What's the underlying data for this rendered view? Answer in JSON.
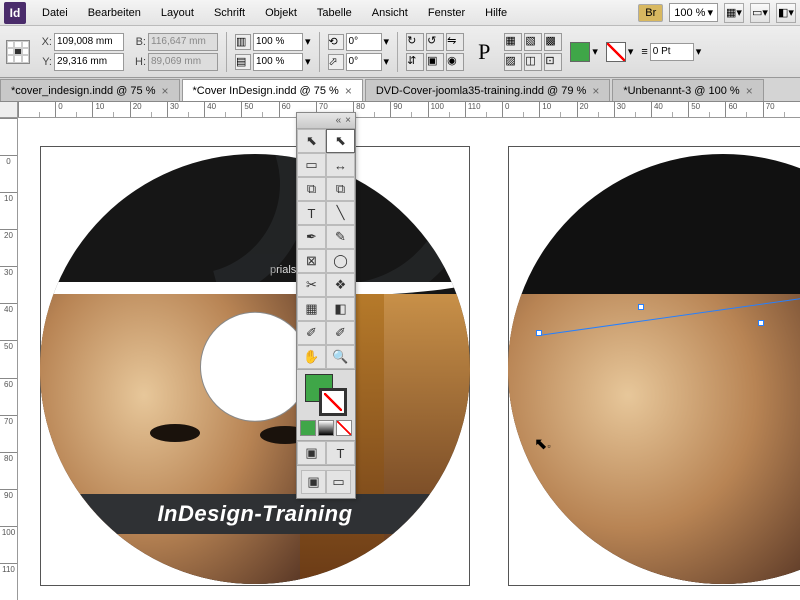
{
  "app": {
    "icon_label": "Id"
  },
  "menu": [
    "Datei",
    "Bearbeiten",
    "Layout",
    "Schrift",
    "Objekt",
    "Tabelle",
    "Ansicht",
    "Fenster",
    "Hilfe"
  ],
  "menubar_right": {
    "badge": "Br",
    "zoom": "100 %"
  },
  "control": {
    "x": "109,008 mm",
    "y": "29,316 mm",
    "w": "116,647 mm",
    "h": "89,069 mm",
    "scale_x": "100 %",
    "scale_y": "100 %",
    "rotate": "0°",
    "shear": "0°",
    "stroke_weight": "0 Pt"
  },
  "tabs": [
    {
      "label": "*cover_indesign.indd @ 75 %",
      "active": false
    },
    {
      "label": "*Cover InDesign.indd @ 75 %",
      "active": true
    },
    {
      "label": "DVD-Cover-joomla35-training.indd @ 79 %",
      "active": false
    },
    {
      "label": "*Unbenannt-3 @ 100 %",
      "active": false
    }
  ],
  "ruler_h": [
    "",
    "0",
    "10",
    "20",
    "30",
    "40",
    "50",
    "60",
    "70",
    "80",
    "90",
    "100",
    "110",
    "0",
    "10",
    "20",
    "30",
    "40",
    "50",
    "60",
    "70"
  ],
  "ruler_v": [
    "",
    "0",
    "10",
    "20",
    "30",
    "40",
    "50",
    "60",
    "70",
    "80",
    "90",
    "100",
    "110"
  ],
  "artwork": {
    "title_band": "InDesign-Training",
    "top_text_fragment": "rials.de"
  },
  "colors": {
    "fill": "#3fa648",
    "accent": "#4a2c6b"
  },
  "toolbox": {
    "tools": [
      {
        "name": "selection-tool",
        "g": "⬉"
      },
      {
        "name": "direct-selection-tool",
        "g": "⬉",
        "sel": true
      },
      {
        "name": "page-tool",
        "g": "▭"
      },
      {
        "name": "gap-tool",
        "g": "↔"
      },
      {
        "name": "content-collector",
        "g": "⧉"
      },
      {
        "name": "content-placer",
        "g": "⧉"
      },
      {
        "name": "type-tool",
        "g": "T"
      },
      {
        "name": "line-tool",
        "g": "╲"
      },
      {
        "name": "pen-tool",
        "g": "✒"
      },
      {
        "name": "pencil-tool",
        "g": "✎"
      },
      {
        "name": "rectangle-frame",
        "g": "⊠"
      },
      {
        "name": "ellipse-tool",
        "g": "◯"
      },
      {
        "name": "scissors-tool",
        "g": "✂"
      },
      {
        "name": "free-transform",
        "g": "❖"
      },
      {
        "name": "gradient-swatch",
        "g": "▦"
      },
      {
        "name": "gradient-feather",
        "g": "◧"
      },
      {
        "name": "note-tool",
        "g": "✐"
      },
      {
        "name": "eyedropper-tool",
        "g": "✐"
      },
      {
        "name": "hand-tool",
        "g": "✋"
      },
      {
        "name": "zoom-tool",
        "g": "🔍"
      }
    ],
    "bottom_tools": [
      {
        "name": "format-container",
        "g": "▣"
      },
      {
        "name": "format-text",
        "g": "T"
      }
    ]
  }
}
